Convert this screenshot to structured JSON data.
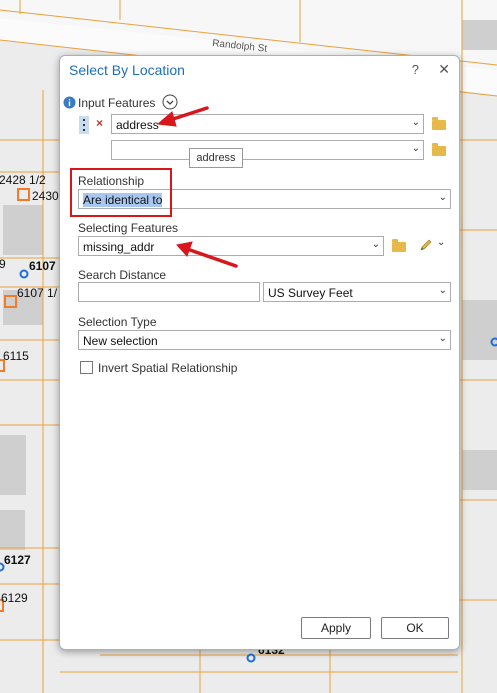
{
  "map": {
    "street_label": "Randolph St",
    "labels": [
      "2428 1/2",
      "2430",
      "9",
      "6107",
      "6107 1/",
      "6115",
      "6127",
      "6129",
      "6132"
    ]
  },
  "dialog": {
    "title": "Select By Location",
    "help": "?",
    "close": "✕",
    "input_features_label": "Input Features",
    "input_value": "address",
    "input_second_value": "",
    "tooltip": "address",
    "relationship_label": "Relationship",
    "relationship_value": "Are identical to",
    "selecting_features_label": "Selecting Features",
    "selecting_value": "missing_addr",
    "search_distance_label": "Search Distance",
    "search_distance_value": "",
    "units_value": "US Survey Feet",
    "selection_type_label": "Selection Type",
    "selection_type_value": "New selection",
    "invert_label": "Invert Spatial Relationship",
    "invert_checked": false,
    "apply_label": "Apply",
    "ok_label": "OK"
  },
  "colors": {
    "accent": "#1f6fb5",
    "annotation": "#d9161c",
    "parcel": "#e8a23a",
    "point_blue": "#1f6fd6",
    "point_orange": "#f07b2a"
  }
}
